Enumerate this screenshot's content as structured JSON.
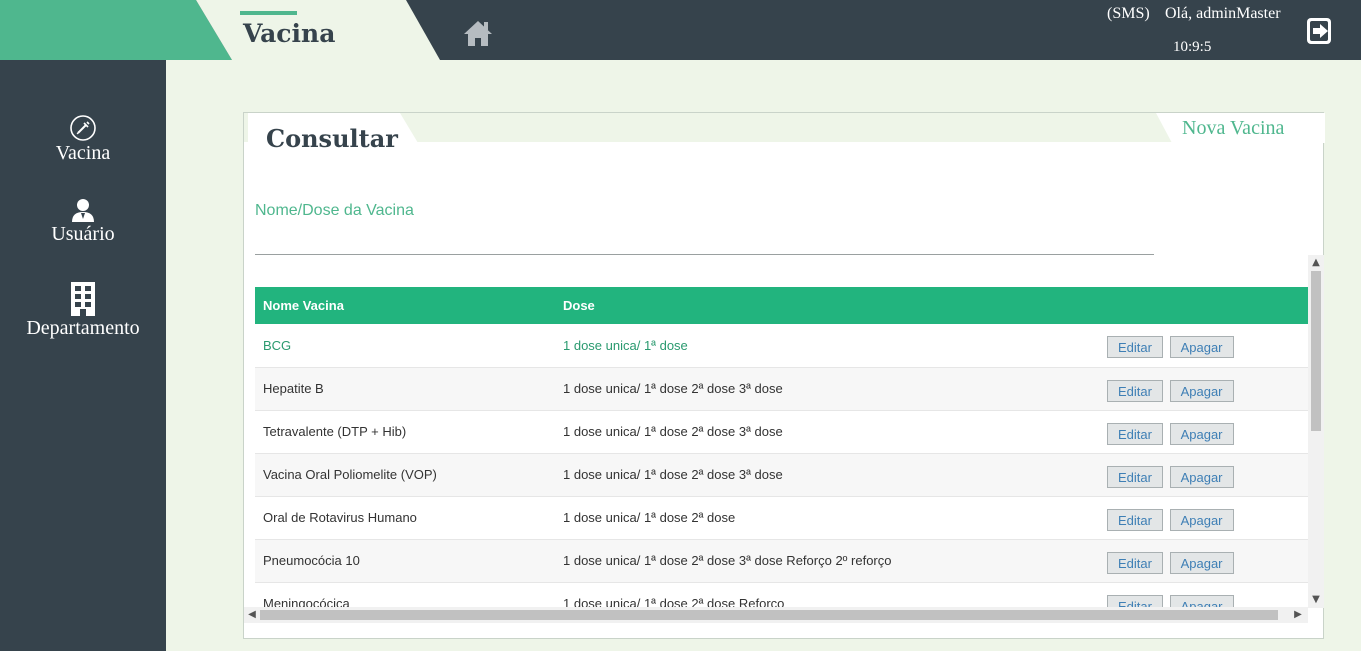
{
  "header": {
    "title": "Vacina",
    "sms_label": "(SMS)",
    "greeting": "Olá, adminMaster",
    "time": "10:9:5",
    "home_icon": "home-icon",
    "logout_icon": "logout-icon"
  },
  "sidebar": {
    "items": [
      {
        "label": "Vacina",
        "icon": "syringe-icon"
      },
      {
        "label": "Usuário",
        "icon": "user-icon"
      },
      {
        "label": "Departamento",
        "icon": "building-icon"
      }
    ]
  },
  "panel": {
    "tab_active": "Consultar",
    "tab_new": "Nova Vacina",
    "search": {
      "label": "Nome/Dose da Vacina",
      "value": "",
      "placeholder": ""
    }
  },
  "table": {
    "headers": [
      "Nome Vacina",
      "Dose"
    ],
    "edit_label": "Editar",
    "delete_label": "Apagar",
    "rows": [
      {
        "name": "BCG",
        "dose": "1 dose unica/ 1ª dose"
      },
      {
        "name": "Hepatite B",
        "dose": "1 dose unica/ 1ª dose 2ª dose 3ª dose"
      },
      {
        "name": "Tetravalente (DTP + Hib)",
        "dose": "1 dose unica/ 1ª dose 2ª dose 3ª dose"
      },
      {
        "name": "Vacina Oral Poliomelite (VOP)",
        "dose": "1 dose unica/ 1ª dose 2ª dose 3ª dose"
      },
      {
        "name": "Oral de Rotavirus Humano",
        "dose": "1 dose unica/ 1ª dose 2ª dose"
      },
      {
        "name": "Pneumocócia 10",
        "dose": "1 dose unica/ 1ª dose 2ª dose 3ª dose Reforço 2º reforço"
      },
      {
        "name": "Meningocócica",
        "dose": "1 dose unica/ 1ª dose 2ª dose Reforço"
      }
    ]
  },
  "colors": {
    "accent": "#4fb78e",
    "table_header": "#22b47e",
    "dark": "#36434c",
    "background": "#eef5e8"
  }
}
